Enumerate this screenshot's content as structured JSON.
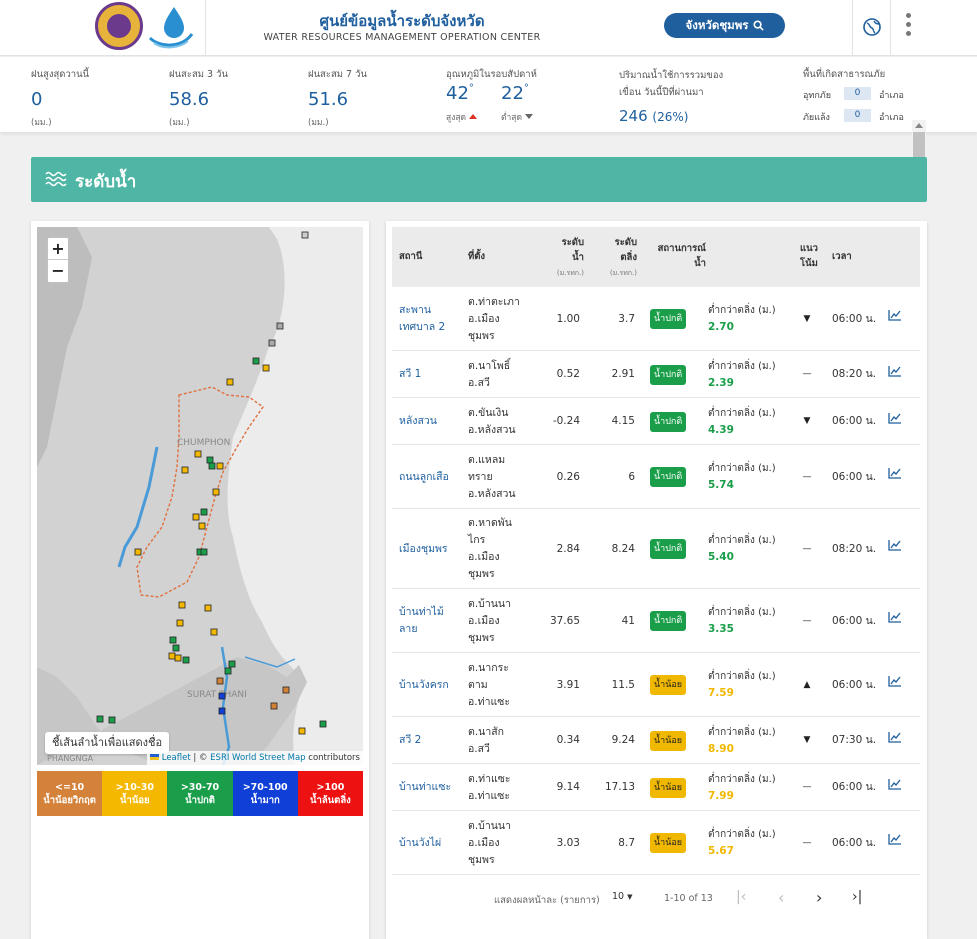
{
  "header": {
    "title_th": "ศูนย์ข้อมูลน้ำระดับจังหวัด",
    "title_en": "WATER RESOURCES MANAGEMENT OPERATION CENTER",
    "province_button": "จังหวัดชุมพร",
    "icons": [
      "crest-logo",
      "water-drop-logo",
      "search-icon",
      "globe-icon",
      "more-vert-icon"
    ]
  },
  "stats": {
    "rain_today": {
      "label": "ฝนสูงสุดวานนี้",
      "value": "0",
      "unit": "(มม.)"
    },
    "rain_3d": {
      "label": "ฝนสะสม 3 วัน",
      "value": "58.6",
      "unit": "(มม.)"
    },
    "rain_7d": {
      "label": "ฝนสะสม 7 วัน",
      "value": "51.6",
      "unit": "(มม.)"
    },
    "temperature": {
      "label": "อุณหภูมิในรอบสัปดาห์",
      "max": "42",
      "min": "22",
      "max_label": "สูงสุด",
      "min_label": "ต่ำสุด",
      "degree": "°"
    },
    "dam": {
      "label1": "ปริมาณน้ำใช้การรวมของ",
      "label2": "เขื่อน วันนี้ปีที่ผ่านมา",
      "value": "246",
      "percent": "(26%)"
    },
    "disaster": {
      "label": "พื้นที่เกิดสาธารณภัย",
      "flood_label": "อุทกภัย",
      "flood_value": "0",
      "drought_label": "ภัยแล้ง",
      "drought_value": "0",
      "unit": "อำเภอ"
    }
  },
  "section": {
    "title": "ระดับน้ำ"
  },
  "map": {
    "zoom_in": "+",
    "zoom_out": "−",
    "tooltip": "ชี้เส้นลำน้ำเพื่อแสดงชื่อ",
    "label_chumphon": "CHUMPHON",
    "label_surat": "SURAT THANI",
    "label_phangnga": "PHANGNGA",
    "attribution": {
      "leaflet": "Leaflet",
      "sep1": " | © ",
      "esri": "ESRI World Street Map",
      "rest": " contributors"
    }
  },
  "legend": [
    {
      "range": "<=10",
      "label": "น้ำน้อยวิกฤต",
      "color": "#d4823a"
    },
    {
      "range": ">10-30",
      "label": "น้ำน้อย",
      "color": "#f5b800"
    },
    {
      "range": ">30-70",
      "label": "น้ำปกติ",
      "color": "#1a9e4a"
    },
    {
      "range": ">70-100",
      "label": "น้ำมาก",
      "color": "#0f3fd6"
    },
    {
      "range": ">100",
      "label": "น้ำล้นตลิ่ง",
      "color": "#ee1111"
    }
  ],
  "table": {
    "headers": {
      "station": "สถานี",
      "location": "ที่ตั้ง",
      "level1": "ระดับ",
      "level2": "น้ำ",
      "level_unit": "(ม.รทก.)",
      "bank1": "ระดับ",
      "bank2": "ตลิ่ง",
      "bank_unit": "(ม.รทก.)",
      "status1": "สถานการณ์",
      "status2": "น้ำ",
      "trend1": "แนว",
      "trend2": "โน้ม",
      "time": "เวลา"
    },
    "rows": [
      {
        "station": [
          "สะพาน",
          "เทศบาล 2"
        ],
        "location": [
          "ต.ท่าตะเภา",
          "อ.เมือง",
          "ชุมพร"
        ],
        "level": "1.00",
        "bank": "3.7",
        "status": "น้ำปกติ",
        "sc": "g",
        "diff_label": "ต่ำกว่าตลิ่ง (ม.)",
        "diff": "2.70",
        "trend": "▼",
        "time": "06:00 น."
      },
      {
        "station": [
          "สวี 1"
        ],
        "location": [
          "ต.นาโพธิ์",
          "อ.สวี"
        ],
        "level": "0.52",
        "bank": "2.91",
        "status": "น้ำปกติ",
        "sc": "g",
        "diff_label": "ต่ำกว่าตลิ่ง (ม.)",
        "diff": "2.39",
        "trend": "—",
        "time": "08:20 น."
      },
      {
        "station": [
          "หลังสวน"
        ],
        "location": [
          "ต.ขันเงิน",
          "อ.หลังสวน"
        ],
        "level": "-0.24",
        "bank": "4.15",
        "status": "น้ำปกติ",
        "sc": "g",
        "diff_label": "ต่ำกว่าตลิ่ง (ม.)",
        "diff": "4.39",
        "trend": "▼",
        "time": "06:00 น."
      },
      {
        "station": [
          "ถนนลูกเสือ"
        ],
        "location": [
          "ต.แหลม",
          "ทราย",
          "อ.หลังสวน"
        ],
        "level": "0.26",
        "bank": "6",
        "status": "น้ำปกติ",
        "sc": "g",
        "diff_label": "ต่ำกว่าตลิ่ง (ม.)",
        "diff": "5.74",
        "trend": "—",
        "time": "06:00 น."
      },
      {
        "station": [
          "เมืองชุมพร"
        ],
        "location": [
          "ต.หาดพัน",
          "ไกร",
          "อ.เมือง",
          "ชุมพร"
        ],
        "level": "2.84",
        "bank": "8.24",
        "status": "น้ำปกติ",
        "sc": "g",
        "diff_label": "ต่ำกว่าตลิ่ง (ม.)",
        "diff": "5.40",
        "trend": "—",
        "time": "08:20 น."
      },
      {
        "station": [
          "บ้านท่าไม้",
          "ลาย"
        ],
        "location": [
          "ต.บ้านนา",
          "อ.เมือง",
          "ชุมพร"
        ],
        "level": "37.65",
        "bank": "41",
        "status": "น้ำปกติ",
        "sc": "g",
        "diff_label": "ต่ำกว่าตลิ่ง (ม.)",
        "diff": "3.35",
        "trend": "—",
        "time": "06:00 น."
      },
      {
        "station": [
          "บ้านวังครก"
        ],
        "location": [
          "ต.นากระ",
          "ตาม",
          "อ.ท่าแซะ"
        ],
        "level": "3.91",
        "bank": "11.5",
        "status": "น้ำน้อย",
        "sc": "y",
        "diff_label": "ต่ำกว่าตลิ่ง (ม.)",
        "diff": "7.59",
        "trend": "▲",
        "time": "06:00 น."
      },
      {
        "station": [
          "สวี 2"
        ],
        "location": [
          "ต.นาสัก",
          "อ.สวี"
        ],
        "level": "0.34",
        "bank": "9.24",
        "status": "น้ำน้อย",
        "sc": "y",
        "diff_label": "ต่ำกว่าตลิ่ง (ม.)",
        "diff": "8.90",
        "trend": "▼",
        "time": "07:30 น."
      },
      {
        "station": [
          "บ้านท่าแซะ"
        ],
        "location": [
          "ต.ท่าแซะ",
          "อ.ท่าแซะ"
        ],
        "level": "9.14",
        "bank": "17.13",
        "status": "น้ำน้อย",
        "sc": "y",
        "diff_label": "ต่ำกว่าตลิ่ง (ม.)",
        "diff": "7.99",
        "trend": "—",
        "time": "06:00 น."
      },
      {
        "station": [
          "บ้านวังไผ่"
        ],
        "location": [
          "ต.บ้านนา",
          "อ.เมือง",
          "ชุมพร"
        ],
        "level": "3.03",
        "bank": "8.7",
        "status": "น้ำน้อย",
        "sc": "y",
        "diff_label": "ต่ำกว่าตลิ่ง (ม.)",
        "diff": "5.67",
        "trend": "—",
        "time": "06:00 น."
      }
    ]
  },
  "pager": {
    "per_page_label": "แสดงผลหน้าละ (รายการ)",
    "per_page": "10",
    "range": "1-10 of 13",
    "first": "|‹",
    "prev": "‹",
    "next": "›",
    "last": "›|"
  },
  "colors": {
    "primary": "#1f5f9e",
    "teal": "#4fb6a6",
    "green": "#1a9e4a",
    "yellow": "#f0b800"
  }
}
